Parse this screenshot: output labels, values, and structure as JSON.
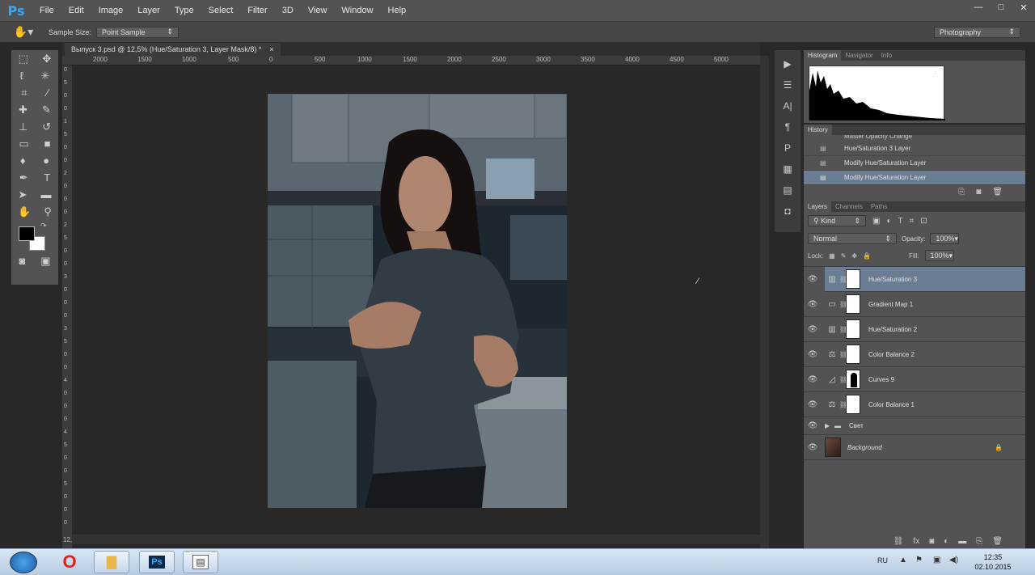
{
  "app": {
    "logo": "Ps"
  },
  "menu": [
    "File",
    "Edit",
    "Image",
    "Layer",
    "Type",
    "Select",
    "Filter",
    "3D",
    "View",
    "Window",
    "Help"
  ],
  "window_controls": {
    "minimize": "—",
    "maximize": "□",
    "close": "✕"
  },
  "options_bar": {
    "sample_size_label": "Sample Size:",
    "sample_size_value": "Point Sample",
    "workspace": "Photography"
  },
  "document": {
    "tab_title": "Выпуск 3.psd @ 12,5% (Hue/Saturation 3, Layer Mask/8) *",
    "close": "×",
    "zoom_readout": "12,"
  },
  "ruler_h": [
    "2000",
    "1500",
    "1000",
    "500",
    "0",
    "500",
    "1000",
    "1500",
    "2000",
    "2500",
    "3000",
    "3500",
    "4000",
    "4500",
    "5000"
  ],
  "ruler_v": [
    "0",
    "5",
    "0",
    "0",
    "1",
    "5",
    "0",
    "0",
    "2",
    "0",
    "0",
    "0",
    "2",
    "5",
    "0",
    "0",
    "3",
    "0",
    "0",
    "0",
    "3",
    "5",
    "0",
    "0",
    "4",
    "0",
    "0",
    "0",
    "4",
    "5",
    "0",
    "0",
    "5",
    "0",
    "0",
    "0"
  ],
  "histogram": {
    "tabs": [
      "Histogram",
      "Navigator",
      "Info"
    ],
    "active": "Histogram",
    "warning_icon": "⚠"
  },
  "history": {
    "tab": "History",
    "items": [
      "Master Opacity Change",
      "Hue/Saturation 3 Layer",
      "Modify Hue/Saturation Layer",
      "Modify Hue/Saturation Layer"
    ],
    "selected_index": 3
  },
  "layers": {
    "tabs": [
      "Layers",
      "Channels",
      "Paths"
    ],
    "active": "Layers",
    "filter": "Kind",
    "blend_mode": "Normal",
    "opacity_label": "Opacity:",
    "opacity": "100%",
    "lock_label": "Lock:",
    "fill_label": "Fill:",
    "fill": "100%",
    "items": [
      {
        "name": "Hue/Saturation 3",
        "selected": true,
        "icon": "hue-sat"
      },
      {
        "name": "Gradient Map 1",
        "selected": false,
        "icon": "gradient-map"
      },
      {
        "name": "Hue/Saturation 2",
        "selected": false,
        "icon": "hue-sat"
      },
      {
        "name": "Color Balance 2",
        "selected": false,
        "icon": "color-balance"
      },
      {
        "name": "Curves 9",
        "selected": false,
        "icon": "curves"
      },
      {
        "name": "Color Balance 1",
        "selected": false,
        "icon": "color-balance"
      }
    ],
    "group": "Свет",
    "background": "Background"
  },
  "taskbar": {
    "lang": "RU",
    "time": "12:35",
    "date": "02.10.2015"
  },
  "colors": {
    "accent": "#31a8ff",
    "selected_row": "#6b7d93",
    "panel": "#535353"
  }
}
